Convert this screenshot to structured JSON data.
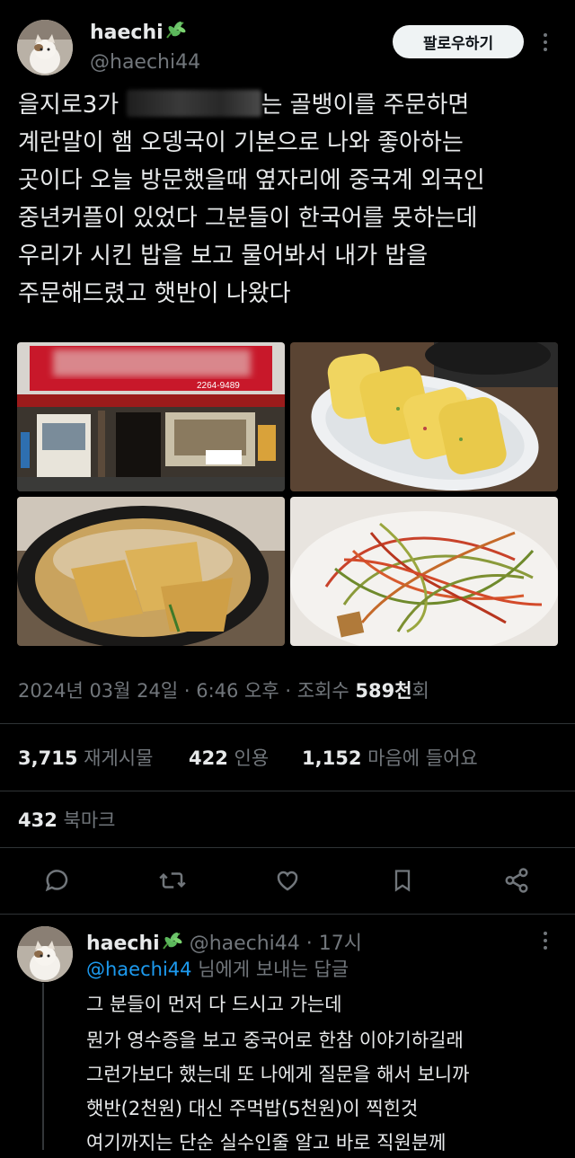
{
  "tweet": {
    "author_name": "haechi",
    "author_handle": "@haechi44",
    "follow_label": "팔로우하기",
    "text_lines": [
      "을지로3가",
      "는 골뱅이를 주문하면",
      "계란말이 햄 오뎅국이 기본으로 나와 좋아하는",
      "곳이다 오늘 방문했을때 옆자리에 중국계 외국인",
      "중년커플이 있었다 그분들이 한국어를 못하는데",
      "우리가 시킨 밥을 보고 물어봐서 내가 밥을",
      "주문해드렸고 햇반이 나왔다"
    ],
    "date": "2024년 03월 24일 · 6:46 오후 · 조회수 ",
    "views_number": "589천",
    "views_suffix": "회",
    "sign_phone": "2264-9489",
    "stats": {
      "retweets_count": "3,715",
      "retweets_label": "재게시물",
      "quotes_count": "422",
      "quotes_label": "인용",
      "likes_count": "1,152",
      "likes_label": "마음에 들어요",
      "bookmarks_count": "432",
      "bookmarks_label": "북마크"
    },
    "icons": [
      "reply-icon",
      "retweet-icon",
      "like-icon",
      "bookmark-icon",
      "share-icon"
    ],
    "leaf_color": "#5cb85c"
  },
  "reply": {
    "author_name": "haechi",
    "author_handle": "@haechi44",
    "time": "· 17시",
    "to_handle": "@haechi44",
    "to_suffix": " 님에게 보내는 답글",
    "text_lines": [
      "그 분들이 먼저 다 드시고 가는데",
      "뭔가 영수증을 보고 중국어로 한참 이야기하길래",
      "그런가보다 했는데 또 나에게 질문을 해서 보니까",
      "햇반(2천원) 대신 주먹밥(5천원)이 찍힌것",
      "여기까지는 단순 실수인줄 알고 바로 직원분께"
    ],
    "link_color": "#1d9bf0"
  }
}
